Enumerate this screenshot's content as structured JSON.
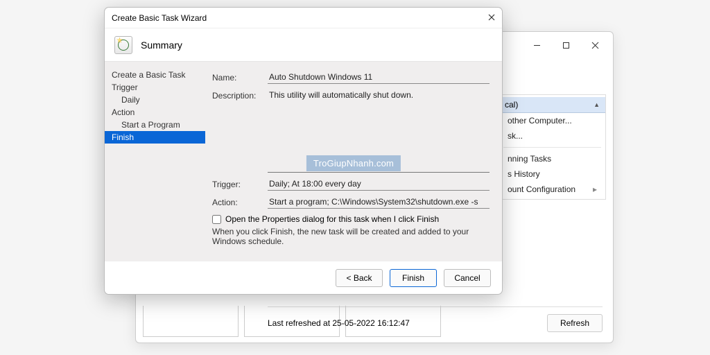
{
  "wizard": {
    "window_title": "Create Basic Task Wizard",
    "page_heading": "Summary",
    "nav": {
      "create": "Create a Basic Task",
      "trigger": "Trigger",
      "trigger_sub": "Daily",
      "action": "Action",
      "action_sub": "Start a Program",
      "finish": "Finish"
    },
    "labels": {
      "name": "Name:",
      "description": "Description:",
      "trigger": "Trigger:",
      "action": "Action:"
    },
    "values": {
      "name": "Auto Shutdown Windows 11",
      "description": "This utility will automatically shut down.",
      "trigger": "Daily; At 18:00 every day",
      "action": "Start a program; C:\\Windows\\System32\\shutdown.exe -s"
    },
    "checkbox_label": "Open the Properties dialog for this task when I click Finish",
    "hint": "When you click Finish, the new task will be created and added to your Windows schedule.",
    "buttons": {
      "back": "< Back",
      "finish": "Finish",
      "cancel": "Cancel"
    }
  },
  "parent": {
    "actions_header": "cal)",
    "actions": {
      "connect": "other Computer...",
      "create_basic": "sk...",
      "running": "nning Tasks",
      "history": "s History",
      "svc_config": "ount Configuration"
    },
    "status": "Last refreshed at 25-05-2022 16:12:47",
    "refresh": "Refresh"
  },
  "watermark": "TroGiupNhanh.com"
}
